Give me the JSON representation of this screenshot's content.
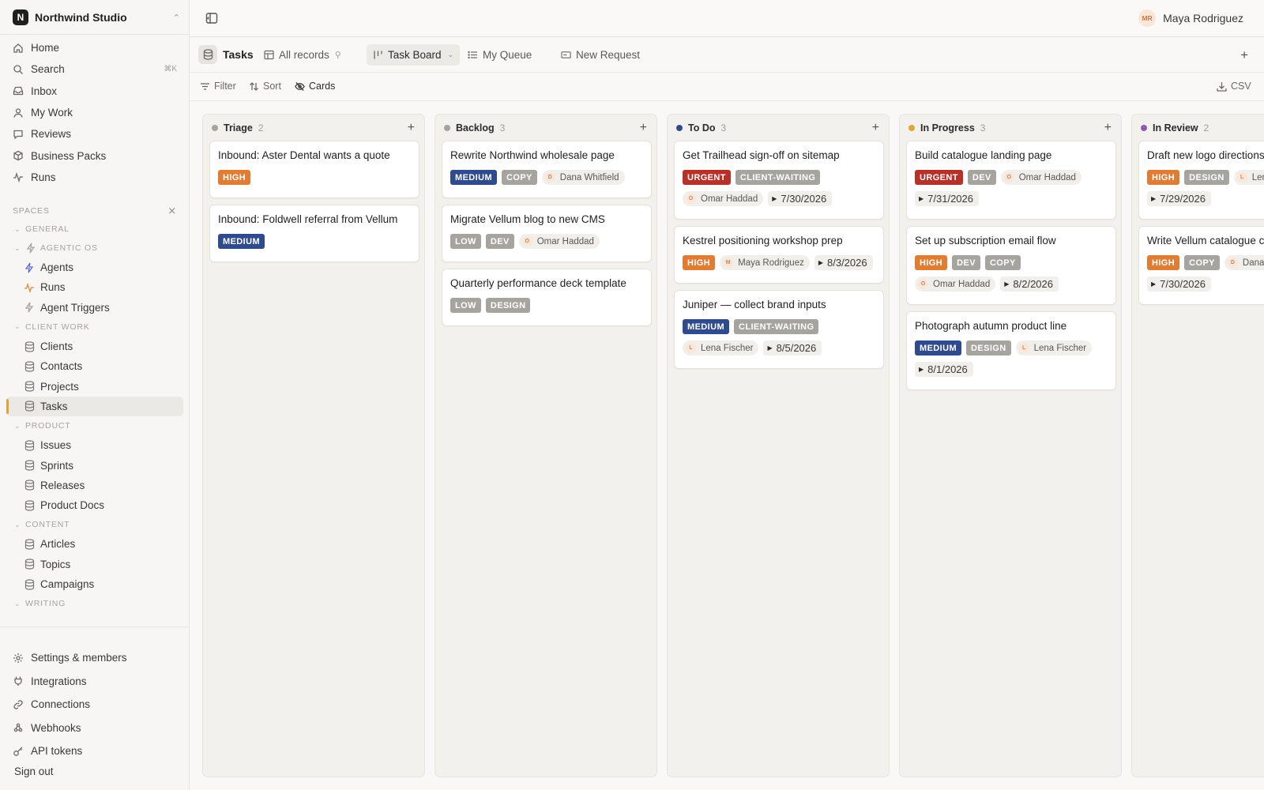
{
  "workspace": {
    "initial": "N",
    "name": "Northwind Studio"
  },
  "user": {
    "initials": "MR",
    "name": "Maya Rodriguez"
  },
  "nav": [
    {
      "label": "Home",
      "icon": "home-icon"
    },
    {
      "label": "Search",
      "icon": "search-icon",
      "shortcut": "⌘K"
    },
    {
      "label": "Inbox",
      "icon": "inbox-icon"
    },
    {
      "label": "My Work",
      "icon": "person-icon"
    },
    {
      "label": "Reviews",
      "icon": "chat-icon"
    },
    {
      "label": "Business Packs",
      "icon": "package-icon"
    },
    {
      "label": "Runs",
      "icon": "activity-icon"
    }
  ],
  "spaces_label": "SPACES",
  "tree": [
    {
      "kind": "group",
      "label": "GENERAL"
    },
    {
      "kind": "group",
      "label": "AGENTIC OS",
      "icon": true
    },
    {
      "kind": "item",
      "label": "Agents",
      "icon": "bolt-icon",
      "color": "#5b6bd6"
    },
    {
      "kind": "item",
      "label": "Runs",
      "icon": "activity-icon",
      "color": "#e0873a"
    },
    {
      "kind": "item",
      "label": "Agent Triggers",
      "icon": "bolt-icon",
      "color": "#a6a39d"
    },
    {
      "kind": "group",
      "label": "CLIENT WORK"
    },
    {
      "kind": "item",
      "label": "Clients",
      "icon": "database-icon"
    },
    {
      "kind": "item",
      "label": "Contacts",
      "icon": "database-icon"
    },
    {
      "kind": "item",
      "label": "Projects",
      "icon": "database-icon"
    },
    {
      "kind": "item",
      "label": "Tasks",
      "icon": "database-icon",
      "active": true
    },
    {
      "kind": "group",
      "label": "PRODUCT"
    },
    {
      "kind": "item",
      "label": "Issues",
      "icon": "database-icon"
    },
    {
      "kind": "item",
      "label": "Sprints",
      "icon": "database-icon"
    },
    {
      "kind": "item",
      "label": "Releases",
      "icon": "database-icon"
    },
    {
      "kind": "item",
      "label": "Product Docs",
      "icon": "database-icon"
    },
    {
      "kind": "group",
      "label": "CONTENT"
    },
    {
      "kind": "item",
      "label": "Articles",
      "icon": "database-icon"
    },
    {
      "kind": "item",
      "label": "Topics",
      "icon": "database-icon"
    },
    {
      "kind": "item",
      "label": "Campaigns",
      "icon": "database-icon"
    },
    {
      "kind": "group",
      "label": "WRITING"
    }
  ],
  "bottom_nav": [
    {
      "label": "Settings & members",
      "icon": "gear-icon"
    },
    {
      "label": "Integrations",
      "icon": "plug-icon"
    },
    {
      "label": "Connections",
      "icon": "link-icon"
    },
    {
      "label": "Webhooks",
      "icon": "webhook-icon"
    },
    {
      "label": "API tokens",
      "icon": "key-icon"
    }
  ],
  "sign_out": "Sign out",
  "page": {
    "title": "Tasks"
  },
  "tabs": [
    {
      "label": "All records",
      "icon": "table-icon",
      "pin": true
    },
    {
      "label": "Task Board",
      "icon": "board-icon",
      "active": true,
      "dropdown": true
    },
    {
      "label": "My Queue",
      "icon": "list-icon"
    },
    {
      "label": "New Request",
      "icon": "form-icon"
    }
  ],
  "toolbar": {
    "filter": "Filter",
    "sort": "Sort",
    "cards": "Cards",
    "csv": "CSV"
  },
  "columns": [
    {
      "title": "Triage",
      "count": "2",
      "color": "#a6a39d",
      "cards": [
        {
          "title": "Inbound: Aster Dental wants a quote",
          "priority": "HIGH"
        },
        {
          "title": "Inbound: Foldwell referral from Vellum",
          "priority": "MEDIUM"
        }
      ]
    },
    {
      "title": "Backlog",
      "count": "3",
      "color": "#a6a39d",
      "cards": [
        {
          "title": "Rewrite Northwind wholesale page",
          "priority": "MEDIUM",
          "tags": [
            "COPY"
          ],
          "assignee": "Dana Whitfield",
          "assignee_initial": "D"
        },
        {
          "title": "Migrate Vellum blog to new CMS",
          "priority": "LOW",
          "tags": [
            "DEV"
          ],
          "assignee": "Omar Haddad",
          "assignee_initial": "O"
        },
        {
          "title": "Quarterly performance deck template",
          "priority": "LOW",
          "tags": [
            "DESIGN"
          ]
        }
      ]
    },
    {
      "title": "To Do",
      "count": "3",
      "color": "#2f4b8e",
      "cards": [
        {
          "title": "Get Trailhead sign-off on sitemap",
          "priority": "URGENT",
          "tags": [
            "CLIENT-WAITING"
          ],
          "assignee": "Omar Haddad",
          "assignee_initial": "O",
          "due": "7/30/2026"
        },
        {
          "title": "Kestrel positioning workshop prep",
          "priority": "HIGH",
          "assignee": "Maya Rodriguez",
          "assignee_initial": "M",
          "due": "8/3/2026"
        },
        {
          "title": "Juniper — collect brand inputs",
          "priority": "MEDIUM",
          "tags": [
            "CLIENT-WAITING"
          ],
          "assignee": "Lena Fischer",
          "assignee_initial": "L",
          "due": "8/5/2026"
        }
      ]
    },
    {
      "title": "In Progress",
      "count": "3",
      "color": "#e0a53a",
      "cards": [
        {
          "title": "Build catalogue landing page",
          "priority": "URGENT",
          "tags": [
            "DEV"
          ],
          "assignee": "Omar Haddad",
          "assignee_initial": "O",
          "due": "7/31/2026"
        },
        {
          "title": "Set up subscription email flow",
          "priority": "HIGH",
          "tags": [
            "DEV",
            "COPY"
          ],
          "assignee": "Omar Haddad",
          "assignee_initial": "O",
          "due": "8/2/2026"
        },
        {
          "title": "Photograph autumn product line",
          "priority": "MEDIUM",
          "tags": [
            "DESIGN"
          ],
          "assignee": "Lena Fischer",
          "assignee_initial": "L",
          "due": "8/1/2026"
        }
      ]
    },
    {
      "title": "In Review",
      "count": "2",
      "color": "#8e5bb0",
      "cards": [
        {
          "title": "Draft new logo directions",
          "priority": "HIGH",
          "tags": [
            "DESIGN"
          ],
          "assignee": "Lena Fischer",
          "assignee_initial": "L",
          "due": "7/29/2026"
        },
        {
          "title": "Write Vellum catalogue copy",
          "priority": "HIGH",
          "tags": [
            "COPY"
          ],
          "assignee": "Dana Whitfield",
          "assignee_initial": "D",
          "due": "7/30/2026"
        }
      ]
    }
  ]
}
